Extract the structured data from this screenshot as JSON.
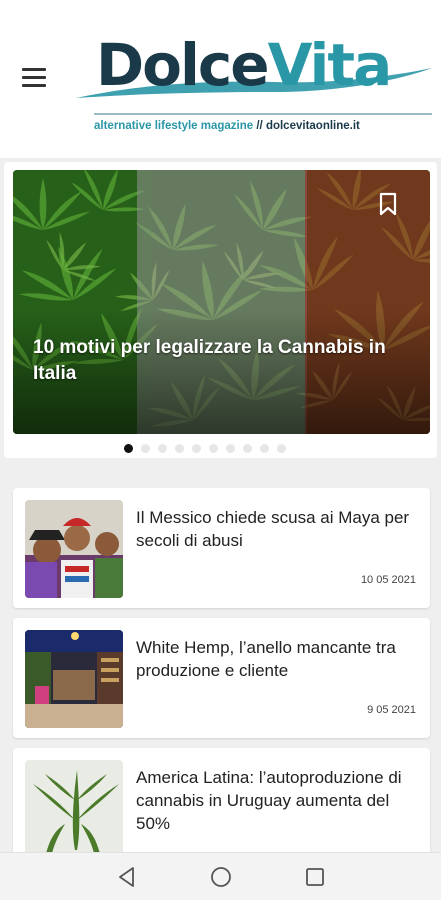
{
  "header": {
    "logo_dolce": "Dolce",
    "logo_vita": "Vita",
    "tagline_part1": "alternative lifestyle magazine",
    "tagline_sep": " // ",
    "tagline_part2": "dolcevitaonline.it"
  },
  "hero": {
    "title": "10 motivi per legalizzare la Cannabis in Italia",
    "slide_count": 10,
    "active_slide": 1
  },
  "articles": [
    {
      "title": "Il Messico chiede scusa ai Maya per secoli di abusi",
      "date": "10 05 2021"
    },
    {
      "title": "White Hemp, l’anello mancante tra produzione e cliente",
      "date": "9 05 2021"
    },
    {
      "title": "America Latina: l’autoproduzione di cannabis in Uruguay aumenta del 50%",
      "date": ""
    }
  ],
  "icons": {
    "menu": "hamburger-menu-icon",
    "bookmark": "bookmark-icon",
    "back": "back-triangle-icon",
    "home": "home-circle-icon",
    "recents": "recents-square-icon"
  },
  "colors": {
    "brand_dark": "#1a3a4a",
    "brand_teal": "#2a97a6"
  }
}
